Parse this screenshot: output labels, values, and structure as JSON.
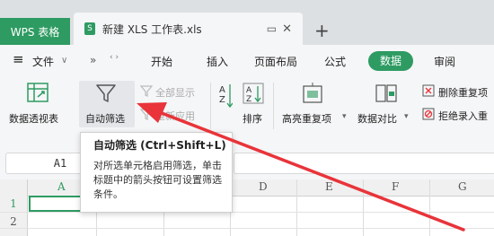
{
  "titlebar": {
    "app_tab": "WPS 表格",
    "doc_tab": "新建 XLS 工作表.xls",
    "doc_icon_letter": "S",
    "add_tab": "+"
  },
  "menubar": {
    "hamburger": "≡",
    "file": "文件",
    "file_caret": "∨",
    "more": "»",
    "items": [
      "开始",
      "插入",
      "页面布局",
      "公式",
      "数据",
      "审阅"
    ],
    "active": "数据"
  },
  "ribbon": {
    "pivot": "数据透视表",
    "autofilter": "自动筛选",
    "show_all": "全部显示",
    "reapply": "重新应用",
    "sort": "排序",
    "highlight_dup": "高亮重复项",
    "highlight_caret": "▾",
    "compare": "数据对比",
    "compare_caret": "▾",
    "remove_dup": "删除重复项",
    "reject_dup": "拒绝录入重"
  },
  "formula": {
    "cell_ref": "A1"
  },
  "grid": {
    "columns": [
      "A",
      "B",
      "C",
      "D",
      "E",
      "F",
      "G"
    ],
    "rows": [
      "1",
      "2"
    ]
  },
  "tooltip": {
    "title": "自动筛选 (Ctrl+Shift+L)",
    "body": "对所选单元格启用筛选，单击标题中的箭头按钮可设置筛选条件。"
  },
  "colors": {
    "accent": "#2e9b62",
    "arrow": "#e8343a"
  }
}
